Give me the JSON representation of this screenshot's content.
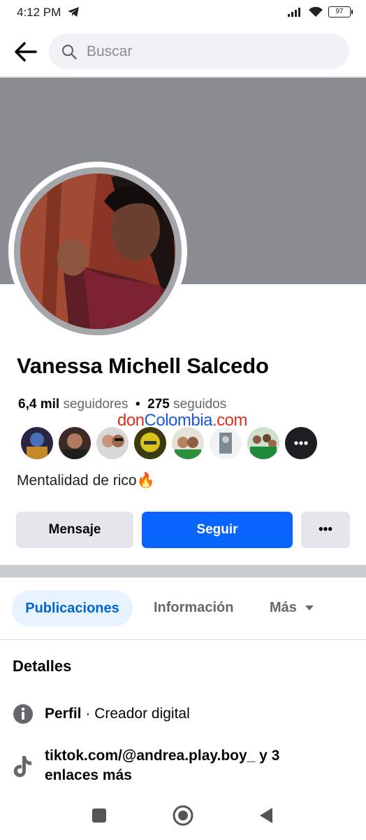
{
  "status_bar": {
    "time": "4:12 PM",
    "battery": "97"
  },
  "search": {
    "placeholder": "Buscar"
  },
  "profile": {
    "name": "Vanessa Michell Salcedo",
    "followers_count": "6,4 mil",
    "followers_label": "seguidores",
    "separator": "•",
    "following_count": "275",
    "following_label": "seguidos",
    "bio": "Mentalidad de rico🔥"
  },
  "watermark": {
    "part1": "don",
    "part2": "Colombia",
    "part3": ".com"
  },
  "actions": {
    "message_label": "Mensaje",
    "follow_label": "Seguir",
    "more_label": "•••"
  },
  "tabs": [
    {
      "label": "Publicaciones",
      "active": true
    },
    {
      "label": "Información",
      "active": false
    },
    {
      "label": "Más",
      "active": false
    }
  ],
  "details": {
    "title": "Detalles",
    "profile_label": "Perfil",
    "profile_sep": " · ",
    "profile_value": "Creador digital",
    "link_text": "tiktok.com/@andrea.play.boy_ y 3 enlaces más"
  },
  "colors": {
    "accent": "#0866ff",
    "cover": "#8a8d91",
    "tab_active_bg": "#e7f3ff"
  }
}
